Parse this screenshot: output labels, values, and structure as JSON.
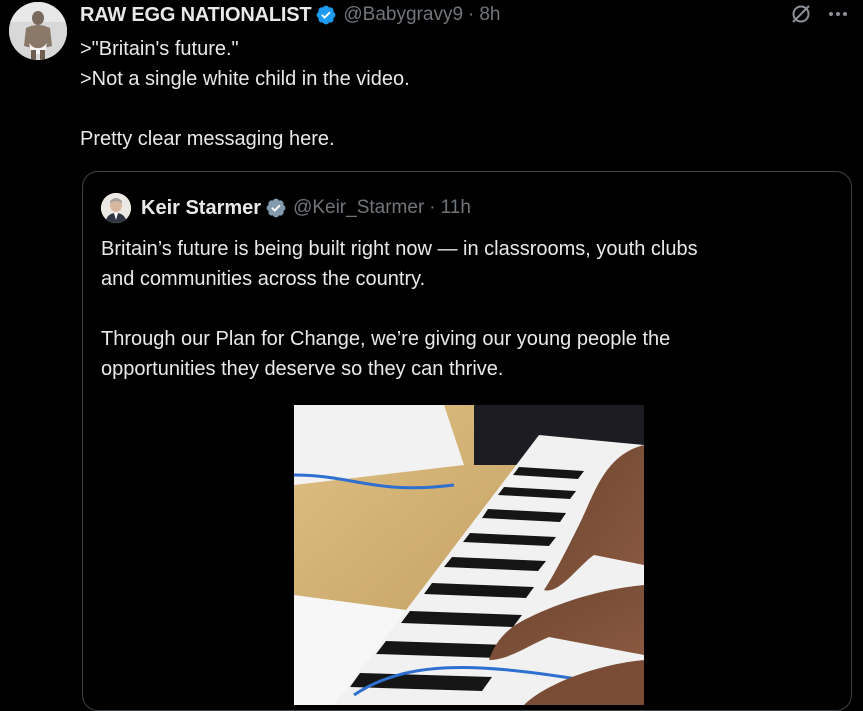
{
  "tweet": {
    "author_name": "RAW EGG NATIONALIST",
    "handle": "@Babygravy9",
    "separator": "·",
    "time": "8h",
    "text_lines": [
      ">\"Britain's future.\"",
      ">Not a single white child in the video.",
      "",
      "Pretty clear messaging here."
    ],
    "icons": [
      "avatar",
      "verified-badge-icon",
      "grok-icon",
      "more-icon"
    ]
  },
  "quote": {
    "author_name": "Keir Starmer",
    "handle": "@Keir_Starmer",
    "separator": "·",
    "time": "11h",
    "text_lines": [
      "Britain’s future is being built right now — in classrooms, youth clubs",
      "and communities across the country.",
      "",
      "Through our Plan for Change, we’re giving our young people the",
      "opportunities they deserve so they can thrive."
    ],
    "media": "piano-keyboard-video"
  },
  "colors": {
    "background": "#000000",
    "text": "#e7e9ea",
    "muted": "#71767b",
    "verified_blue": "#1d9bf0",
    "verified_gray": "#829aab",
    "border": "#3d4247"
  }
}
